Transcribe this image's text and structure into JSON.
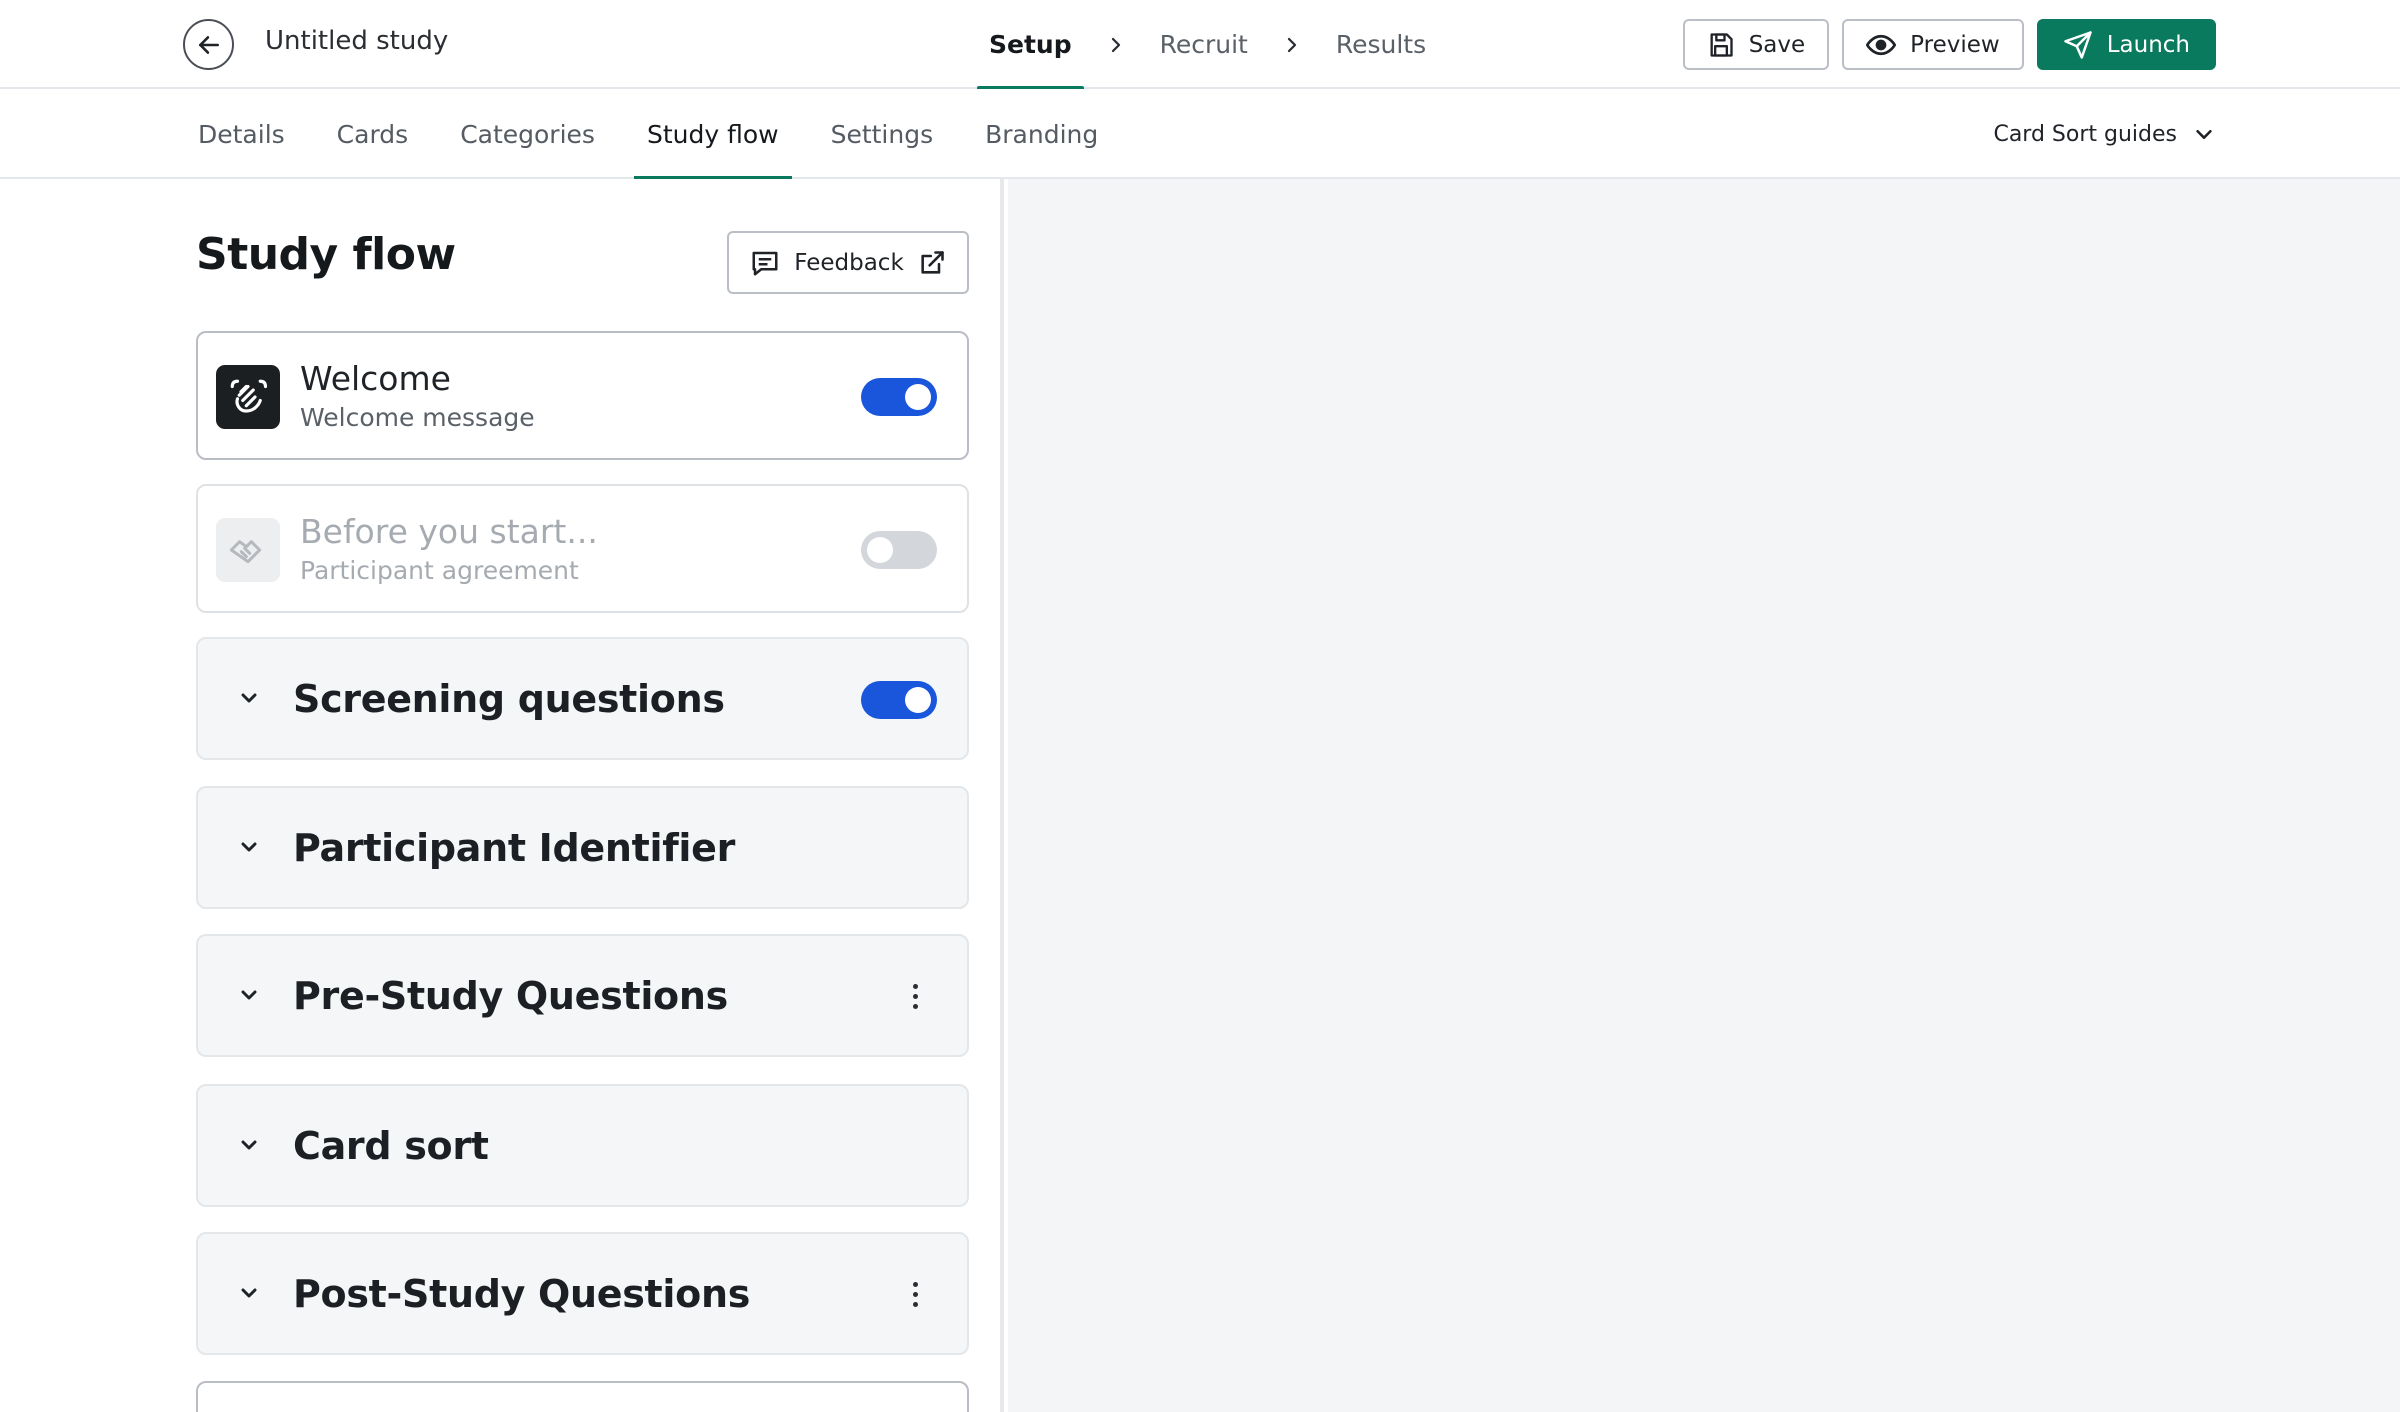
{
  "header": {
    "study_title": "Untitled study",
    "steps": [
      {
        "label": "Setup"
      },
      {
        "label": "Recruit"
      },
      {
        "label": "Results"
      }
    ],
    "actions": {
      "save_label": "Save",
      "preview_label": "Preview",
      "launch_label": "Launch"
    }
  },
  "subnav": {
    "tabs": [
      {
        "label": "Details"
      },
      {
        "label": "Cards"
      },
      {
        "label": "Categories"
      },
      {
        "label": "Study flow"
      },
      {
        "label": "Settings"
      },
      {
        "label": "Branding"
      }
    ],
    "guides_label": "Card Sort guides"
  },
  "panel": {
    "title": "Study flow",
    "feedback_label": "Feedback",
    "welcome": {
      "title": "Welcome",
      "subtitle": "Welcome message",
      "enabled": true
    },
    "before_start": {
      "title": "Before you start...",
      "subtitle": "Participant agreement",
      "enabled": false
    },
    "sections": [
      {
        "title": "Screening questions",
        "toggle": true,
        "enabled": true
      },
      {
        "title": "Participant Identifier"
      },
      {
        "title": "Pre-Study Questions",
        "menu": true
      },
      {
        "title": "Card sort"
      },
      {
        "title": "Post-Study Questions",
        "menu": true
      }
    ]
  },
  "colors": {
    "accent": "#0a7a5e",
    "toggle_on": "#1a56db",
    "toggle_off": "#d3d6da",
    "preview_bg": "#f4f5f7"
  },
  "icons": {
    "back": "arrow-left-icon",
    "save": "floppy-disk-icon",
    "preview": "eye-icon",
    "launch": "paper-plane-icon",
    "feedback": "message-icon",
    "external": "external-link-icon",
    "welcome": "waving-hand-icon",
    "agreement": "handshake-icon"
  }
}
